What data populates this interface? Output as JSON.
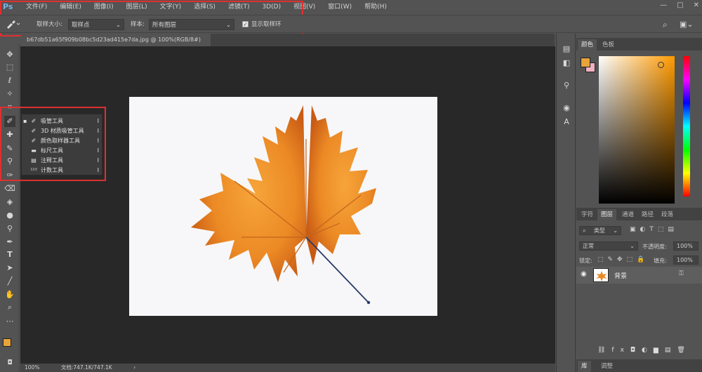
{
  "app": {
    "logo": "Ps"
  },
  "menu": [
    "文件(F)",
    "编辑(E)",
    "图像(I)",
    "图层(L)",
    "文字(Y)",
    "选择(S)",
    "滤镜(T)",
    "3D(D)",
    "视图(V)",
    "窗口(W)",
    "帮助(H)"
  ],
  "window_controls": [
    "—",
    "□",
    "✕"
  ],
  "options": {
    "sample_size_label": "取样大小:",
    "sample_size_value": "取样点",
    "sample_label": "样本:",
    "sample_value": "所有图层",
    "show_ring_label": "显示取样环",
    "show_ring_checked": true
  },
  "document": {
    "tab_title": "b67db51a65f909b08bc5d23ad415e7da.jpg @ 100%(RGB/8#)",
    "close": "×"
  },
  "flyout": [
    {
      "icon": "eyedropper-icon",
      "label": "吸管工具",
      "key": "I",
      "active": true
    },
    {
      "icon": "3d-eyedropper-icon",
      "label": "3D 材质吸管工具",
      "key": "I",
      "active": false
    },
    {
      "icon": "color-sampler-icon",
      "label": "颜色取样器工具",
      "key": "I",
      "active": false
    },
    {
      "icon": "ruler-icon",
      "label": "标尺工具",
      "key": "I",
      "active": false
    },
    {
      "icon": "note-icon",
      "label": "注释工具",
      "key": "I",
      "active": false
    },
    {
      "icon": "count-icon",
      "label": "计数工具",
      "key": "I",
      "active": false
    }
  ],
  "color_panel": {
    "tabs": [
      "颜色",
      "色板"
    ],
    "foreground": "#e8a33a",
    "background": "#f0b0c0"
  },
  "layers_panel": {
    "tabs": [
      "字符",
      "图层",
      "通道",
      "路径",
      "段落"
    ],
    "filter_label": "类型",
    "blend_mode": "正常",
    "opacity_label": "不透明度:",
    "opacity_value": "100%",
    "lock_label": "锁定:",
    "fill_label": "填充:",
    "fill_value": "100%",
    "layers": [
      {
        "name": "背景",
        "visible": true,
        "locked": true
      }
    ]
  },
  "bottom_tabs": [
    "库",
    "调整"
  ],
  "status": {
    "zoom": "100%",
    "doc_info": "文档:747.1K/747.1K"
  },
  "colors": {
    "accent_red": "#e03030",
    "ui_gray": "#535353",
    "canvas_bg": "#282828"
  }
}
